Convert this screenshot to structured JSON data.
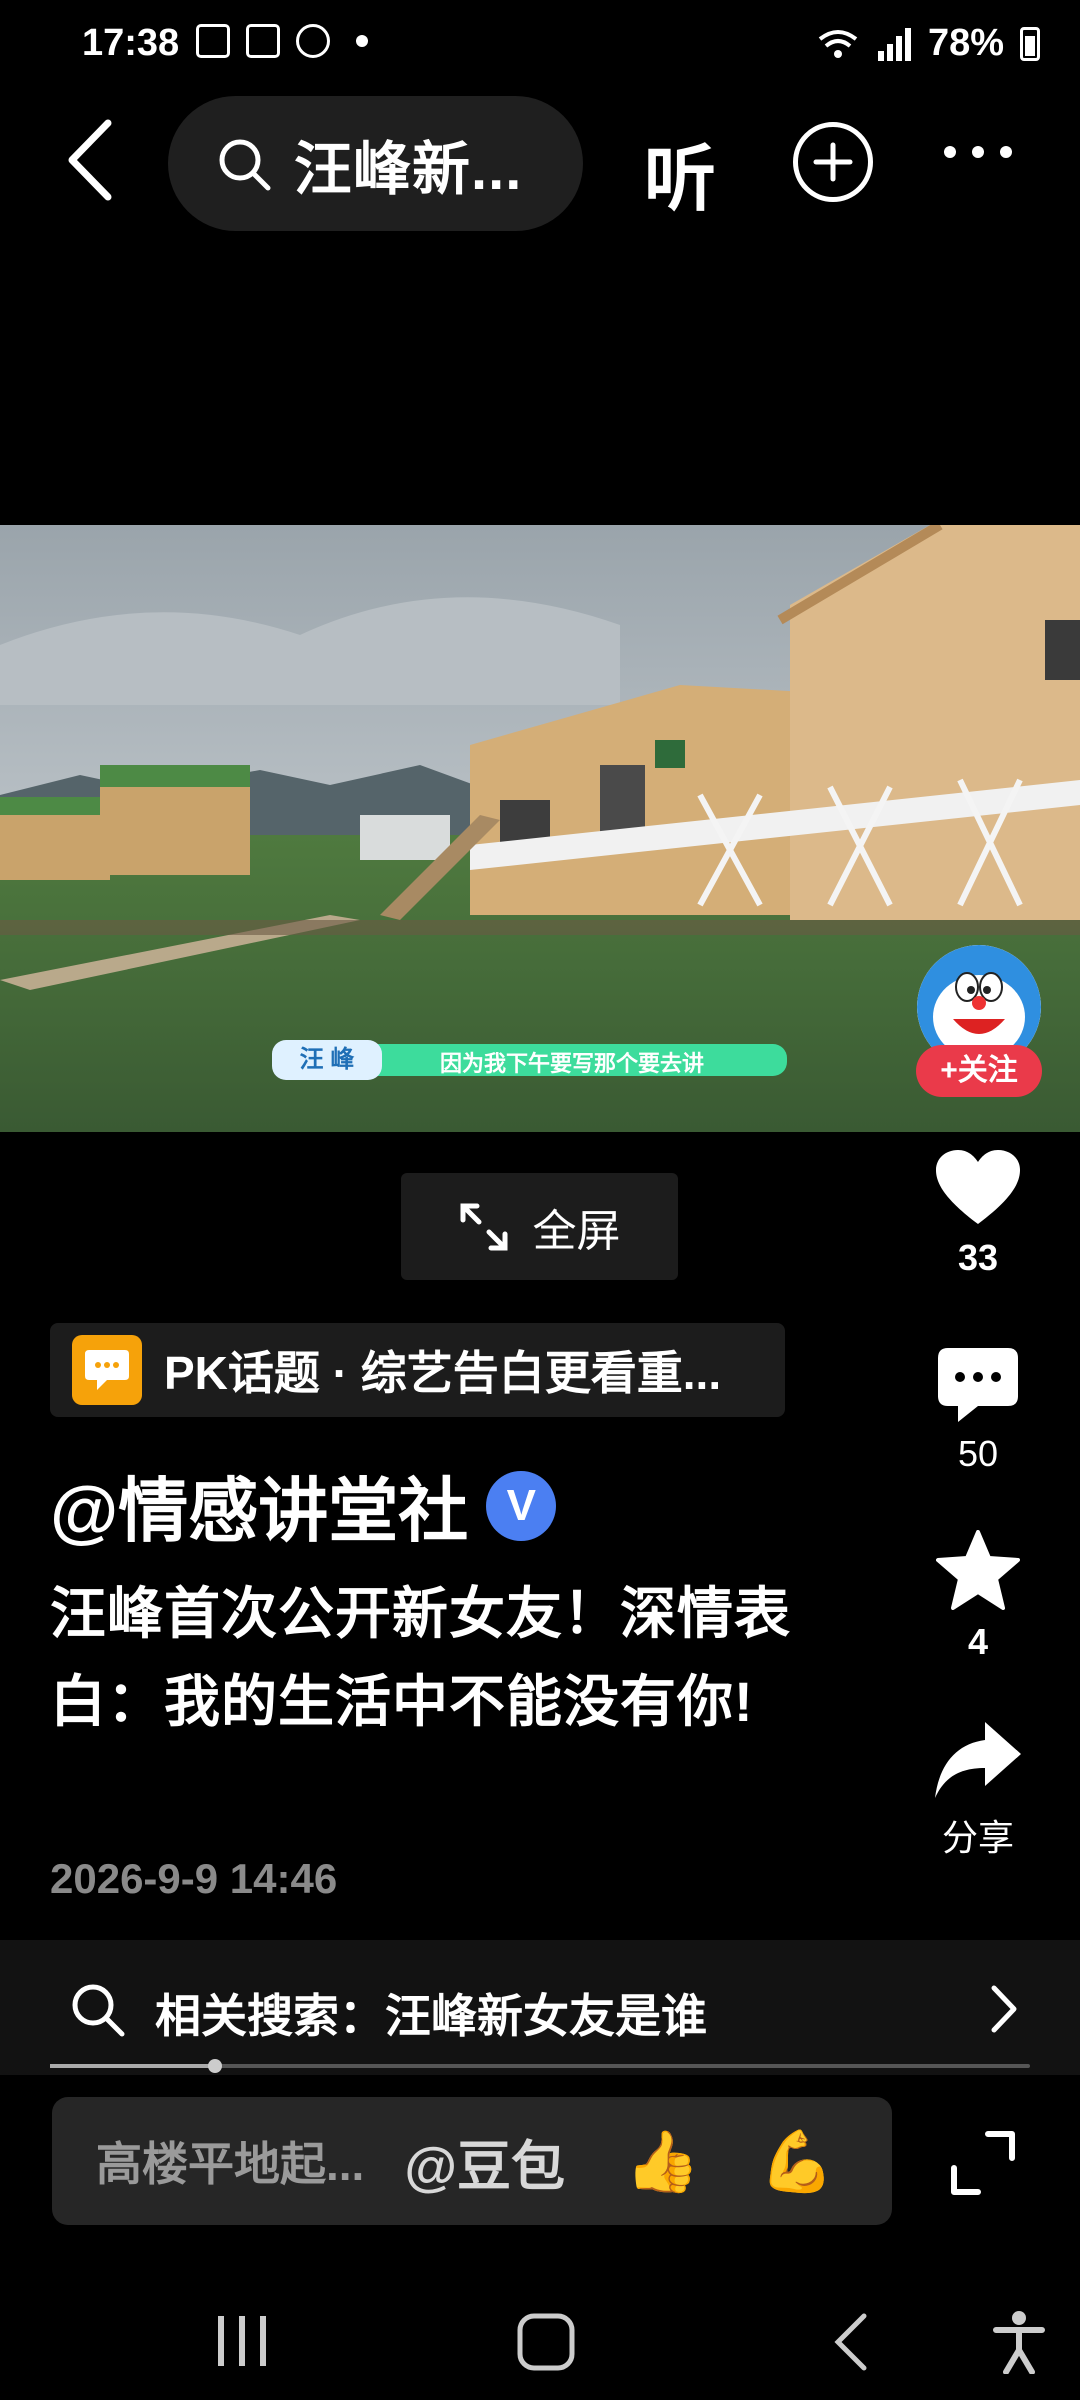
{
  "status_bar": {
    "time": "17:38",
    "battery": "78%"
  },
  "header": {
    "search_title": "汪峰新...",
    "listen_label": "听"
  },
  "video": {
    "subtitle_name": "汪 峰",
    "subtitle_text": "因为我下午要写那个要去讲",
    "follow_label": "+关注"
  },
  "fullscreen_label": "全屏",
  "actions": {
    "likes": "33",
    "comments": "50",
    "favorites": "4",
    "share_label": "分享"
  },
  "topic": {
    "text": "PK话题 · 综艺告白更看重..."
  },
  "post": {
    "author": "@情感讲堂社",
    "verified_mark": "V",
    "description": "汪峰首次公开新女友！深情表白：我的生活中不能没有你!",
    "date": "2026-9-9 14:46"
  },
  "related_search": {
    "text": "相关搜索：汪峰新女友是谁"
  },
  "comment_bar": {
    "placeholder": "高楼平地起...",
    "mention": "@豆包",
    "emoji_1": "👍",
    "emoji_2": "💪"
  },
  "colors": {
    "background": "#000000",
    "follow": "#ea3a4a",
    "verified": "#4b7ff2",
    "topic_icon": "#f6a20a"
  }
}
